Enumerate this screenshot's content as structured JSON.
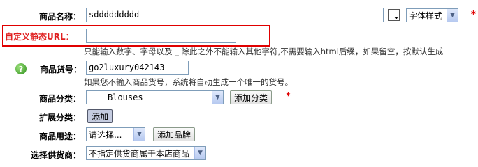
{
  "fields": {
    "name": {
      "label": "商品名称：",
      "value": "sddddddddd",
      "font_style_select": "字体样式",
      "required_mark": "*"
    },
    "url": {
      "label": "自定义静态URL：",
      "value": "",
      "hint": "只能输入数字、字母以及 _ 除此之外不能输入其他字符,不需要输入html后缀，如果留空，按默认生成"
    },
    "sn": {
      "label": "商品货号：",
      "value": "go2luxury042143",
      "hint": "如果您不输入商品货号，系统将自动生成一个唯一的货号。"
    },
    "category": {
      "label": "商品分类：",
      "selected": "Blouses",
      "add_button": "添加分类",
      "required_mark": "*"
    },
    "extend_category": {
      "label": "扩展分类：",
      "add_button": "添加"
    },
    "usage": {
      "label": "商品用途：",
      "selected": "请选择...",
      "add_brand_button": "添加品牌"
    },
    "supplier": {
      "label": "选择供货商：",
      "selected": "不指定供货商属于本店商品"
    }
  },
  "colors": {
    "highlight_border": "#e00000",
    "input_border": "#7f9db9",
    "required": "#e00000"
  }
}
